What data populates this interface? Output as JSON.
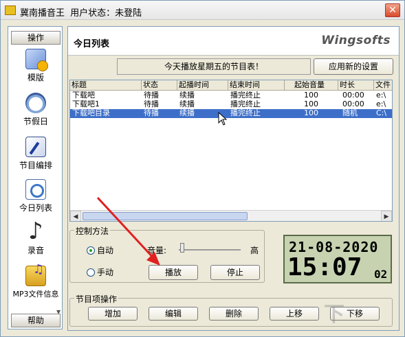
{
  "window": {
    "app_name": "冀南播音王",
    "user_status": "用户状态：未登陆",
    "close_glyph": "✕"
  },
  "sidebar": {
    "header": "操作",
    "footer": "帮助",
    "items": [
      {
        "label": "模版",
        "icon": "template-icon"
      },
      {
        "label": "节假日",
        "icon": "holiday-clock-icon"
      },
      {
        "label": "节目编排",
        "icon": "program-edit-icon"
      },
      {
        "label": "今日列表",
        "icon": "today-list-icon"
      },
      {
        "label": "录音",
        "icon": "record-music-icon"
      },
      {
        "label": "MP3文件信息",
        "icon": "mp3-folder-icon"
      }
    ]
  },
  "main": {
    "title": "今日列表",
    "brand": "Wingsofts",
    "notice": "今天播放星期五的节目表！",
    "apply_button": "应用新的设置",
    "table": {
      "columns": [
        "标题",
        "状态",
        "起播时间",
        "结束时间",
        "起始音量",
        "时长",
        "文件"
      ],
      "rows": [
        {
          "title": "下载吧",
          "status": "待播",
          "start": "续播",
          "end": "播完终止",
          "volume": "100",
          "duration": "00:00",
          "file": "e:\\"
        },
        {
          "title": "下载吧1",
          "status": "待播",
          "start": "续播",
          "end": "播完终止",
          "volume": "100",
          "duration": "00:00",
          "file": "e:\\"
        },
        {
          "title": "下载吧目录",
          "status": "待播",
          "start": "续播",
          "end": "播完终止",
          "volume": "100",
          "duration": "随机",
          "file": "C:\\"
        }
      ]
    },
    "control": {
      "label": "控制方法",
      "auto": "自动",
      "manual": "手动",
      "volume_label": "音量:",
      "volume_high": "高",
      "volume_level": 0.05,
      "play": "播放",
      "stop": "停止"
    },
    "clock": {
      "date": "21-08-2020",
      "time": "15:07",
      "seconds": "02"
    },
    "ops": {
      "label": "节目项操作",
      "add": "增加",
      "edit": "编辑",
      "delete": "删除",
      "up": "上移",
      "down": "下移"
    }
  },
  "colors": {
    "selection": "#3d6fc9",
    "annotation_arrow": "#e02020",
    "lcd_bg": "#c7d3b0"
  }
}
